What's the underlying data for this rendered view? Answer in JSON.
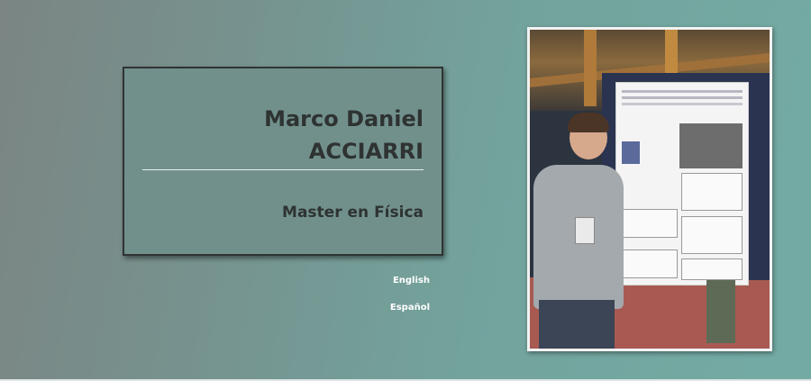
{
  "profile": {
    "first_names": "Marco Daniel",
    "last_name": "ACCIARRI",
    "degree": "Master en Física"
  },
  "languages": [
    {
      "label": "English"
    },
    {
      "label": "Español"
    }
  ],
  "photo": {
    "description_icon": "portrait-photo"
  },
  "colors": {
    "background_left": "#7b8583",
    "background_right": "#73aba4",
    "card_border": "#2f3433",
    "text_dark": "#2e3332",
    "link_text": "#ffffff"
  }
}
